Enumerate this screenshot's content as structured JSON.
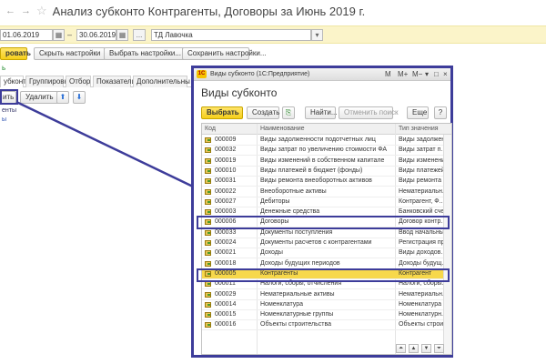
{
  "window": {
    "title": "Анализ субконто Контрагенты, Договоры  за Июнь 2019 г.",
    "nav_back": "←",
    "nav_fwd": "→",
    "star": "☆"
  },
  "filters": {
    "date_from": "01.06.2019",
    "date_to": "30.06.2019",
    "organization": "ТД Лавочка",
    "dots": "..."
  },
  "toolbar": {
    "generate_label": "ровать",
    "hide_settings_label": "Скрыть настройки",
    "choose_settings_label": "Выбрать настройки...",
    "save_settings_label": "Сохранить настройки..."
  },
  "left_panel": {
    "green_text": "ь",
    "tabs": [
      "убконто",
      "Группировка",
      "Отбор",
      "Показатели",
      "Дополнительны"
    ],
    "add_label": "ить",
    "delete_label": "Удалить",
    "item1": "енты",
    "item2": "ы"
  },
  "dialog": {
    "window_title": "Виды субконто  (1С:Предприятие)",
    "logo": "1С",
    "title_buttons": [
      "M",
      "M+",
      "M−",
      "▾",
      "□",
      "×"
    ],
    "heading": "Виды субконто",
    "buttons": {
      "select": "Выбрать",
      "create": "Создать",
      "find": "Найти...",
      "cancel_search": "Отменить поиск",
      "more": "Еще",
      "help": "?"
    },
    "columns": [
      "Код",
      "Наименование",
      "Тип значения"
    ],
    "rows": [
      {
        "code": "000009",
        "name": "Виды задолженности подотчетных лиц",
        "type": "Виды задолжен..."
      },
      {
        "code": "000032",
        "name": "Виды затрат по увеличению стоимости ФА",
        "type": "Виды затрат п..."
      },
      {
        "code": "000019",
        "name": "Виды изменений в собственном капитале",
        "type": "Виды изменени..."
      },
      {
        "code": "000010",
        "name": "Виды платежей в бюджет (фонды)",
        "type": "Виды платежей..."
      },
      {
        "code": "000031",
        "name": "Виды ремонта внеоборотных активов",
        "type": "Виды ремонта ..."
      },
      {
        "code": "000022",
        "name": "Внеоборотные активы",
        "type": "Нематериальн..."
      },
      {
        "code": "000027",
        "name": "Дебиторы",
        "type": "Контрагент, Ф..."
      },
      {
        "code": "000003",
        "name": "Денежные средства",
        "type": "Банковский сче..."
      },
      {
        "code": "000006",
        "name": "Договоры",
        "type": "Договор контр..."
      },
      {
        "code": "000033",
        "name": "Документы поступления",
        "type": "Ввод начальны..."
      },
      {
        "code": "000024",
        "name": "Документы расчетов с контрагентами",
        "type": "Регистрация пр..."
      },
      {
        "code": "000021",
        "name": "Доходы",
        "type": "Виды доходов..."
      },
      {
        "code": "000018",
        "name": "Доходы будущих периодов",
        "type": "Доходы будущ..."
      },
      {
        "code": "000005",
        "name": "Контрагенты",
        "type": "Контрагент"
      },
      {
        "code": "000011",
        "name": "Налоги, сборы, отчисления",
        "type": "Налоги, сборы..."
      },
      {
        "code": "000029",
        "name": "Нематериальные активы",
        "type": "Нематериальн..."
      },
      {
        "code": "000014",
        "name": "Номенклатура",
        "type": "Номенклатура"
      },
      {
        "code": "000015",
        "name": "Номенклатурные группы",
        "type": "Номенклатурн..."
      },
      {
        "code": "000016",
        "name": "Объекты строительства",
        "type": "Объекты строи..."
      }
    ],
    "selected_code": "000005",
    "nav": [
      "⏶",
      "▲",
      "▼",
      "⏷"
    ]
  },
  "colors": {
    "accent_frame": "#3d3c9a",
    "selection": "#f7d84b",
    "yellow_bar": "#fbf4c9",
    "primary_button": "#f6cf1a"
  }
}
